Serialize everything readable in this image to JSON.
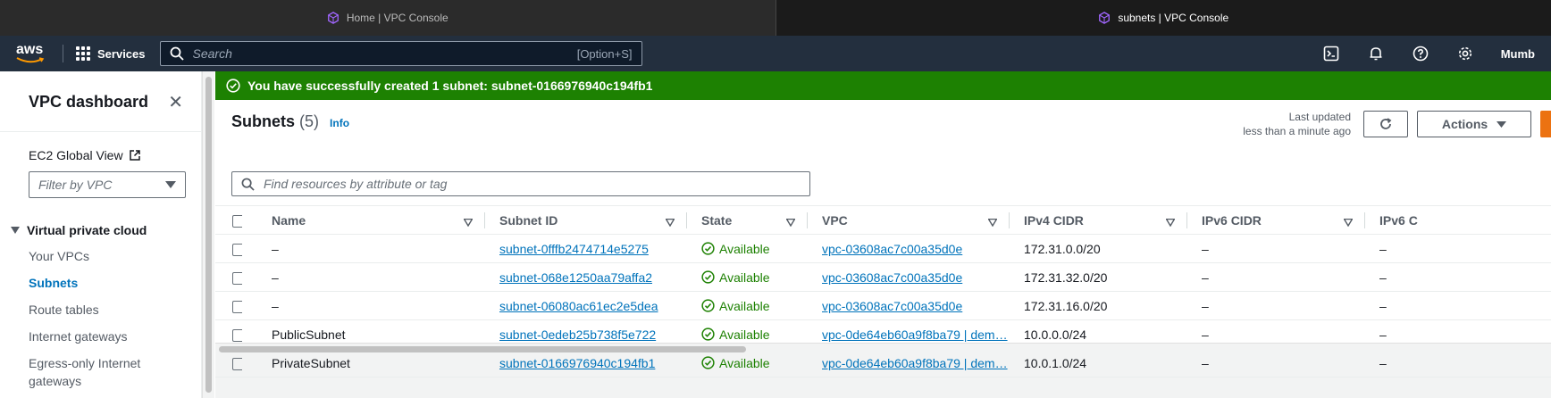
{
  "browser": {
    "tabs": [
      {
        "title": "Home | VPC Console",
        "active": false
      },
      {
        "title": "subnets | VPC Console",
        "active": true
      }
    ]
  },
  "topnav": {
    "logo": "aws",
    "services_label": "Services",
    "search_placeholder": "Search",
    "search_shortcut": "[Option+S]",
    "region": "Mumb"
  },
  "sidebar": {
    "title": "VPC dashboard",
    "ec2_global_view": "EC2 Global View",
    "filter_placeholder": "Filter by VPC",
    "section": "Virtual private cloud",
    "items": [
      {
        "label": "Your VPCs",
        "active": false
      },
      {
        "label": "Subnets",
        "active": true
      },
      {
        "label": "Route tables",
        "active": false
      },
      {
        "label": "Internet gateways",
        "active": false
      },
      {
        "label": "Egress-only Internet gateways",
        "active": false
      }
    ]
  },
  "flash": {
    "message": "You have successfully created 1 subnet: subnet-0166976940c194fb1"
  },
  "panel": {
    "title": "Subnets",
    "count": "(5)",
    "info": "Info",
    "last_updated_label": "Last updated",
    "last_updated_value": "less than a minute ago",
    "actions_label": "Actions",
    "filter_placeholder": "Find resources by attribute or tag"
  },
  "table": {
    "columns": [
      "Name",
      "Subnet ID",
      "State",
      "VPC",
      "IPv4 CIDR",
      "IPv6 CIDR",
      "IPv6 C"
    ],
    "rows": [
      {
        "name": "–",
        "subnet_id": "subnet-0fffb2474714e5275",
        "state": "Available",
        "vpc": "vpc-03608ac7c00a35d0e",
        "ipv4": "172.31.0.0/20",
        "ipv6": "–",
        "ipv6b": "–"
      },
      {
        "name": "–",
        "subnet_id": "subnet-068e1250aa79affa2",
        "state": "Available",
        "vpc": "vpc-03608ac7c00a35d0e",
        "ipv4": "172.31.32.0/20",
        "ipv6": "–",
        "ipv6b": "–"
      },
      {
        "name": "–",
        "subnet_id": "subnet-06080ac61ec2e5dea",
        "state": "Available",
        "vpc": "vpc-03608ac7c00a35d0e",
        "ipv4": "172.31.16.0/20",
        "ipv6": "–",
        "ipv6b": "–"
      },
      {
        "name": "PublicSubnet",
        "subnet_id": "subnet-0edeb25b738f5e722",
        "state": "Available",
        "vpc": "vpc-0de64eb60a9f8ba79 | dem…",
        "ipv4": "10.0.0.0/24",
        "ipv6": "–",
        "ipv6b": "–"
      },
      {
        "name": "PrivateSubnet",
        "subnet_id": "subnet-0166976940c194fb1",
        "state": "Available",
        "vpc": "vpc-0de64eb60a9f8ba79 | dem…",
        "ipv4": "10.0.1.0/24",
        "ipv6": "–",
        "ipv6b": "–"
      }
    ]
  },
  "colors": {
    "nav_bg": "#232f3e",
    "success_green": "#1d8102",
    "link_blue": "#0073bb",
    "primary_orange": "#ec7211"
  }
}
